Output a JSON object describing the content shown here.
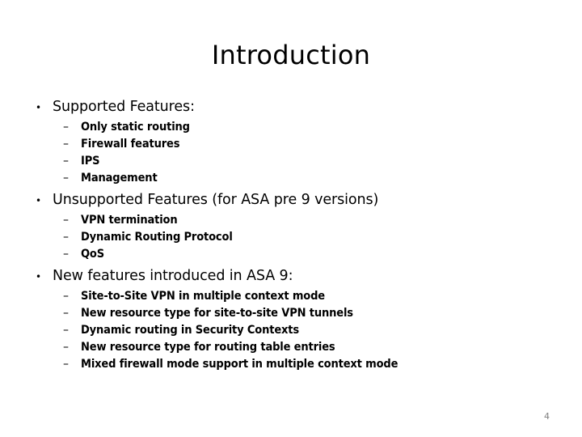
{
  "slide": {
    "title": "Introduction",
    "page_number": "4",
    "bullet_marker": "•",
    "dash_marker": "–",
    "groups": [
      {
        "heading": "Supported Features:",
        "items": [
          "Only static routing",
          "Firewall features",
          "IPS",
          "Management"
        ]
      },
      {
        "heading": "Unsupported Features (for ASA pre 9 versions)",
        "items": [
          "VPN termination",
          "Dynamic Routing Protocol",
          "QoS"
        ]
      },
      {
        "heading": "New features introduced in ASA 9:",
        "items": [
          "Site-to-Site VPN in multiple context mode",
          "New resource type for site-to-site VPN tunnels",
          "Dynamic routing in Security Contexts",
          "New resource type for routing table entries",
          "Mixed firewall mode support in multiple context mode"
        ]
      }
    ]
  },
  "colors": {
    "background": "#ffffff",
    "text": "#000000",
    "page_number": "#808080"
  }
}
